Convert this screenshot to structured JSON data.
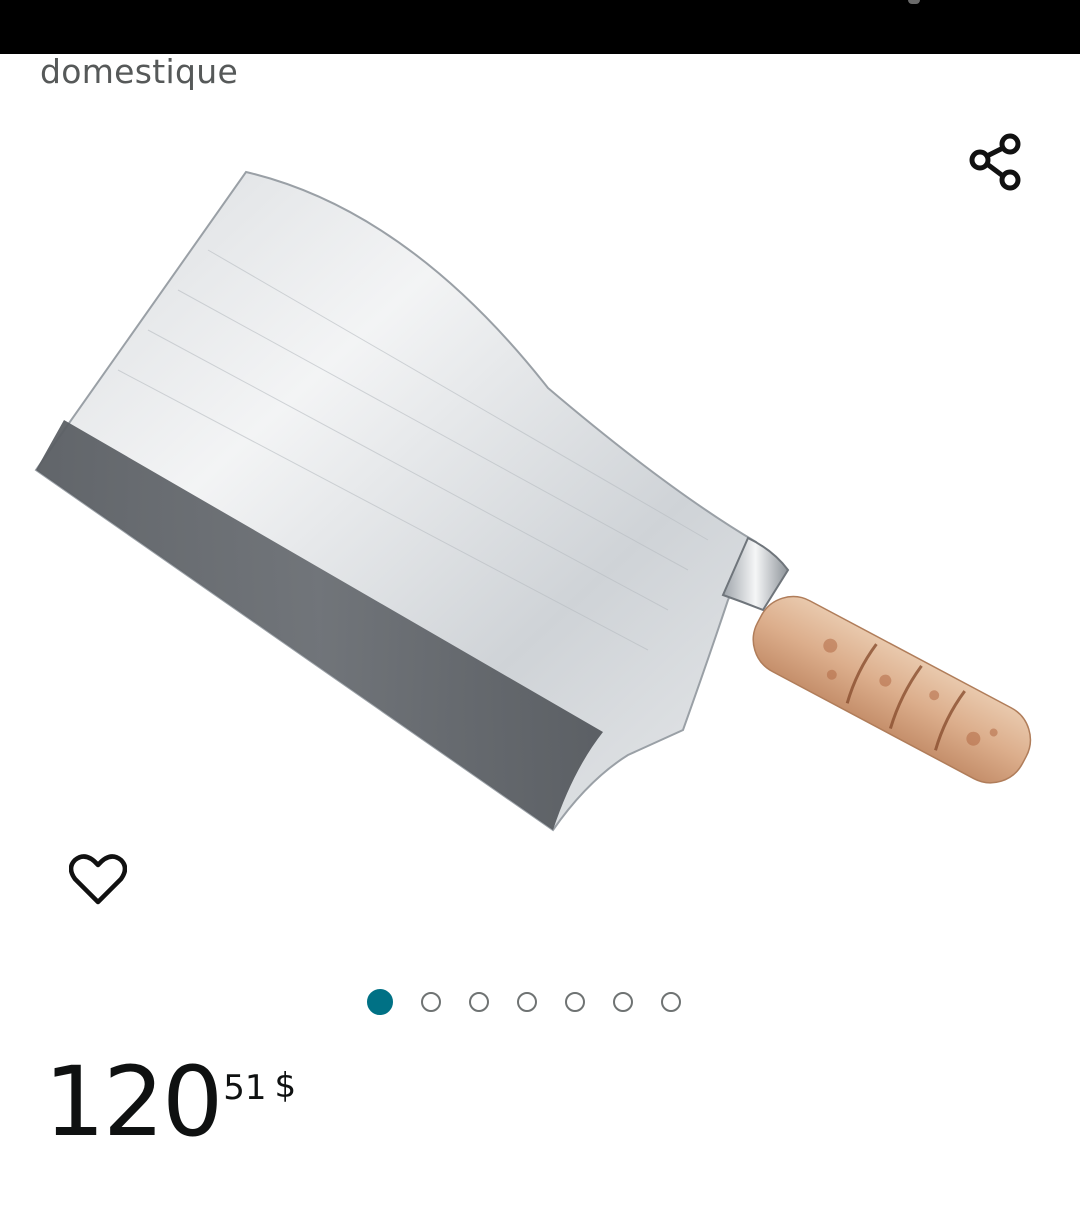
{
  "header": {
    "category": "domestique"
  },
  "product": {
    "image_icon": "cleaver-knife-image",
    "share_icon": "share-icon",
    "wishlist_icon": "heart-icon"
  },
  "carousel": {
    "total_images": 7,
    "active_index": 0
  },
  "price": {
    "whole": "120",
    "fraction": "51",
    "currency": "$"
  },
  "colors": {
    "accent": "#007185",
    "text": "#0f1111",
    "muted": "#565959",
    "status_bar": "#000000"
  }
}
